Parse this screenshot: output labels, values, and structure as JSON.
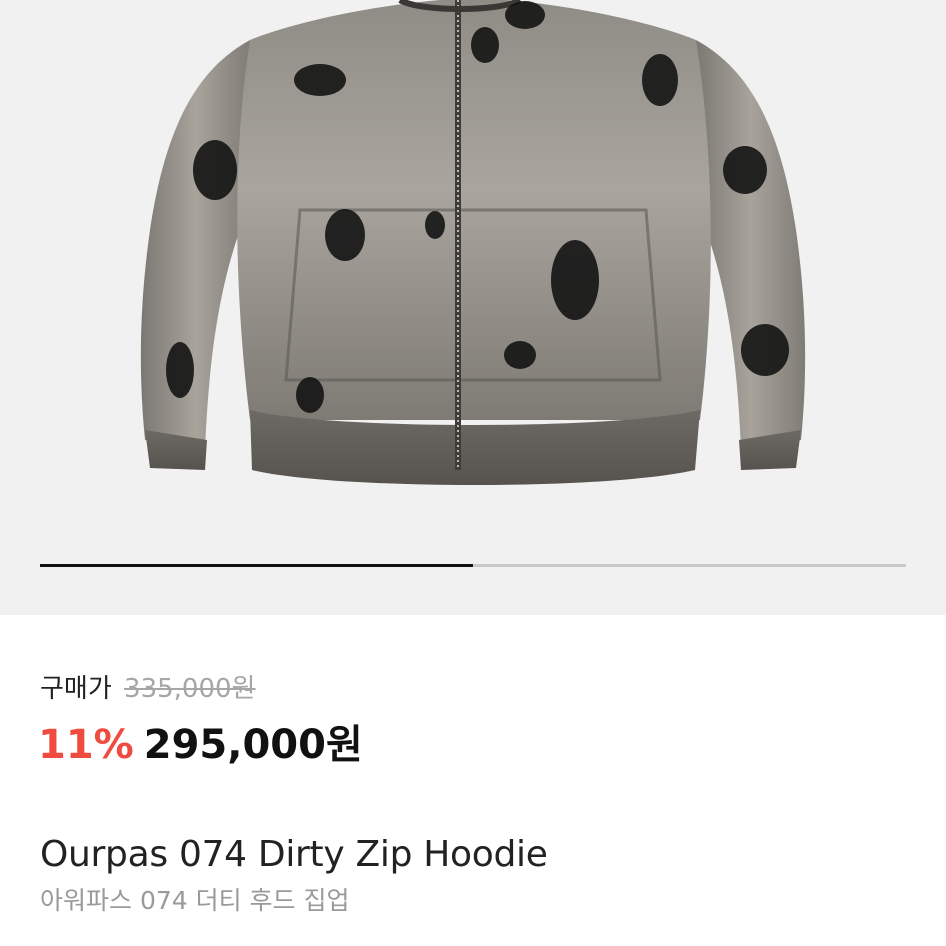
{
  "product": {
    "image_alt_icon": "hoodie-product-image",
    "image_progress": 0.5,
    "price_label": "구매가",
    "original_price": "335,000원",
    "discount_rate": "11%",
    "sale_price": "295,000원",
    "name_en": "Ourpas 074 Dirty Zip Hoodie",
    "name_ko": "아워파스 074 더티 후드 집업"
  },
  "colors": {
    "discount": "#ef4b3f",
    "hero_background": "#f1f1f1",
    "progress_active": "#111111",
    "progress_track": "#c9c9c9"
  }
}
